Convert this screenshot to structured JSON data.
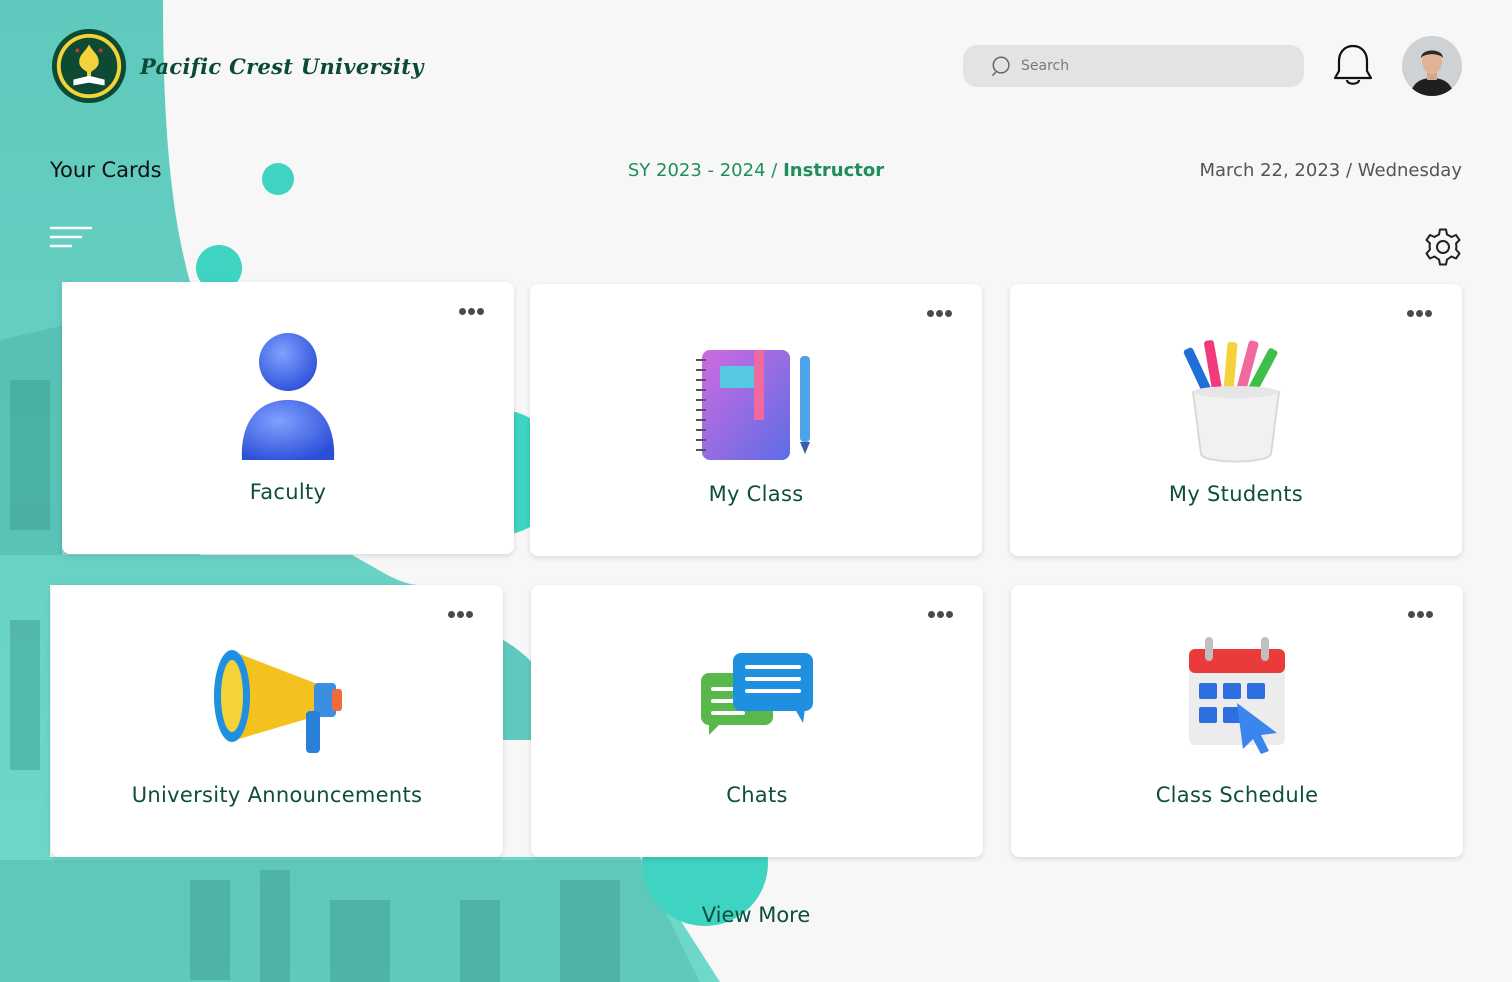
{
  "brand": {
    "name": "Pacific Crest University",
    "logo_icon": "university-seal-icon",
    "color": "#0d4a34"
  },
  "search": {
    "placeholder": "Search"
  },
  "header": {
    "section_title": "Your Cards",
    "school_year": "SY 2023 - 2024",
    "separator": "/",
    "role": "Instructor",
    "date": "March 22, 2023",
    "day": "Wednesday"
  },
  "cards": [
    {
      "label": "Faculty",
      "icon": "person-icon"
    },
    {
      "label": "My Class",
      "icon": "notebook-icon"
    },
    {
      "label": "My Students",
      "icon": "pencil-cup-icon"
    },
    {
      "label": "University Announcements",
      "icon": "megaphone-icon"
    },
    {
      "label": "Chats",
      "icon": "chat-bubbles-icon"
    },
    {
      "label": "Class Schedule",
      "icon": "calendar-icon"
    }
  ],
  "footer": {
    "view_more": "View More"
  },
  "colors": {
    "accent": "#1e8f5b",
    "teal": "#3fd3c2",
    "heading": "#0e4f3c"
  }
}
